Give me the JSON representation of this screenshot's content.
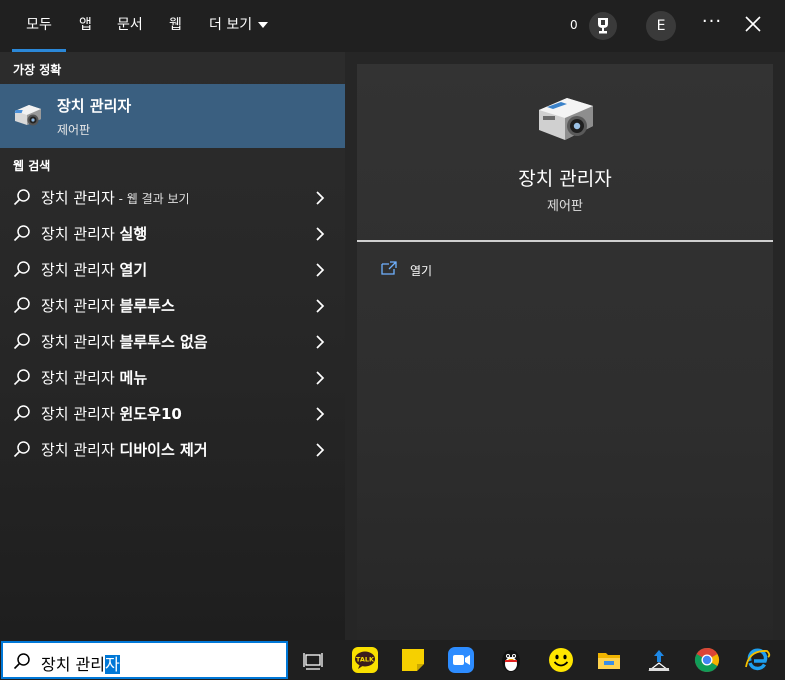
{
  "tabs": {
    "all": "모두",
    "apps": "앱",
    "documents": "문서",
    "web": "웹",
    "more": "더 보기"
  },
  "header": {
    "points": "0",
    "avatar_letter": "E",
    "more_icon": "ellipsis-icon",
    "close_icon": "close-icon"
  },
  "best_match": {
    "section_label": "가장 정확",
    "title": "장치 관리자",
    "subtitle": "제어판"
  },
  "web_search": {
    "section_label": "웹 검색",
    "items": [
      {
        "query": "장치 관리자",
        "suffix": "",
        "small": " - 웹 결과 보기"
      },
      {
        "query": "장치 관리자 ",
        "suffix": "실행",
        "small": ""
      },
      {
        "query": "장치 관리자 ",
        "suffix": "열기",
        "small": ""
      },
      {
        "query": "장치 관리자 ",
        "suffix": "블루투스",
        "small": ""
      },
      {
        "query": "장치 관리자 ",
        "suffix": "블루투스 없음",
        "small": ""
      },
      {
        "query": "장치 관리자 ",
        "suffix": "메뉴",
        "small": ""
      },
      {
        "query": "장치 관리자 ",
        "suffix": "윈도우10",
        "small": ""
      },
      {
        "query": "장치 관리자 ",
        "suffix": "디바이스 제거",
        "small": ""
      }
    ]
  },
  "detail": {
    "title": "장치 관리자",
    "subtitle": "제어판",
    "actions": [
      {
        "label": "열기",
        "icon": "open-icon"
      }
    ]
  },
  "search": {
    "typed": "장치 관리",
    "selected": "자"
  },
  "taskbar": {
    "icons": [
      "task-view-icon",
      "kakaotalk-icon",
      "sticky-notes-icon",
      "zoom-icon",
      "penguin-app-icon",
      "smiley-app-icon",
      "file-explorer-icon",
      "store-app-icon",
      "chrome-icon",
      "internet-explorer-icon"
    ],
    "kakao_label": "TALK"
  },
  "colors": {
    "accent": "#0078d7",
    "selected_row": "#3a5f80"
  }
}
